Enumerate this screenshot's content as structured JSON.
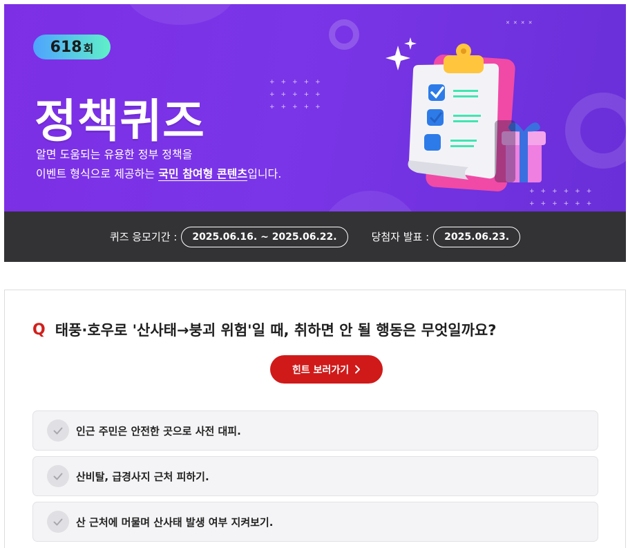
{
  "banner": {
    "episode_number": "618",
    "episode_unit": "회",
    "title": "정책퀴즈",
    "desc_line1": "알면 도움되는 유용한 정부 정책을",
    "desc_line2_prefix": "이벤트 형식으로 제공하는 ",
    "desc_line2_highlight": "국민 참여형 콘텐츠",
    "desc_line2_suffix": "입니다.",
    "illustration_icon": "clipboard-checklist-gift-illustration"
  },
  "period": {
    "apply_label": "퀴즈 응모기간 :",
    "apply_value": "2025.06.16. ~ 2025.06.22.",
    "announce_label": "당첨자 발표 :",
    "announce_value": "2025.06.23."
  },
  "quiz": {
    "q_mark": "Q",
    "question": "태풍·호우로 '산사태→붕괴 위험'일 때, 취하면 안 될 행동은 무엇일까요?",
    "hint_button": "힌트 보러가기",
    "options": [
      {
        "text": "인근 주민은 안전한 곳으로 사전 대피."
      },
      {
        "text": "산비탈, 급경사지 근처 피하기."
      },
      {
        "text": "산 근처에 머물며 산사태 발생 여부 지켜보기."
      }
    ]
  },
  "colors": {
    "banner_purple": "#7a35e8",
    "badge_gradient_start": "#4ea3ff",
    "badge_gradient_end": "#5ff0c8",
    "period_bar": "#333336",
    "accent_red": "#d01a1a"
  }
}
